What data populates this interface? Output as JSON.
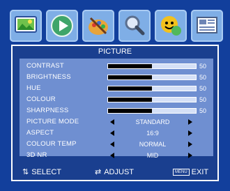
{
  "menu": {
    "title": "PICTURE",
    "sliders": [
      {
        "label": "CONTRAST",
        "value": "50",
        "level": 0.5
      },
      {
        "label": "BRIGHTNESS",
        "value": "50",
        "level": 0.5
      },
      {
        "label": "HUE",
        "value": "50",
        "level": 0.5
      },
      {
        "label": "COLOUR",
        "value": "50",
        "level": 0.5
      },
      {
        "label": "SHARPNESS",
        "value": "50",
        "level": 0.5
      }
    ],
    "options": [
      {
        "label": "PICTURE MODE",
        "value": "STANDARD"
      },
      {
        "label": "ASPECT",
        "value": "16:9"
      },
      {
        "label": "COLOUR TEMP",
        "value": "NORMAL"
      },
      {
        "label": "3D NR",
        "value": "MID"
      }
    ]
  },
  "footer": {
    "select_label": "SELECT",
    "adjust_label": "ADJUST",
    "menu_key_label": "MENU",
    "exit_label": "EXIT"
  },
  "icons": [
    "picture-icon",
    "play-icon",
    "palette-icon",
    "magnifier-icon",
    "smiley-icon",
    "settings-icon"
  ],
  "colors": {
    "background": "#123f9c",
    "panel": "#1a3f8f",
    "inner": "#6f8fd1",
    "bar_track": "#d5e0f6",
    "bar_fill": "#000000"
  }
}
